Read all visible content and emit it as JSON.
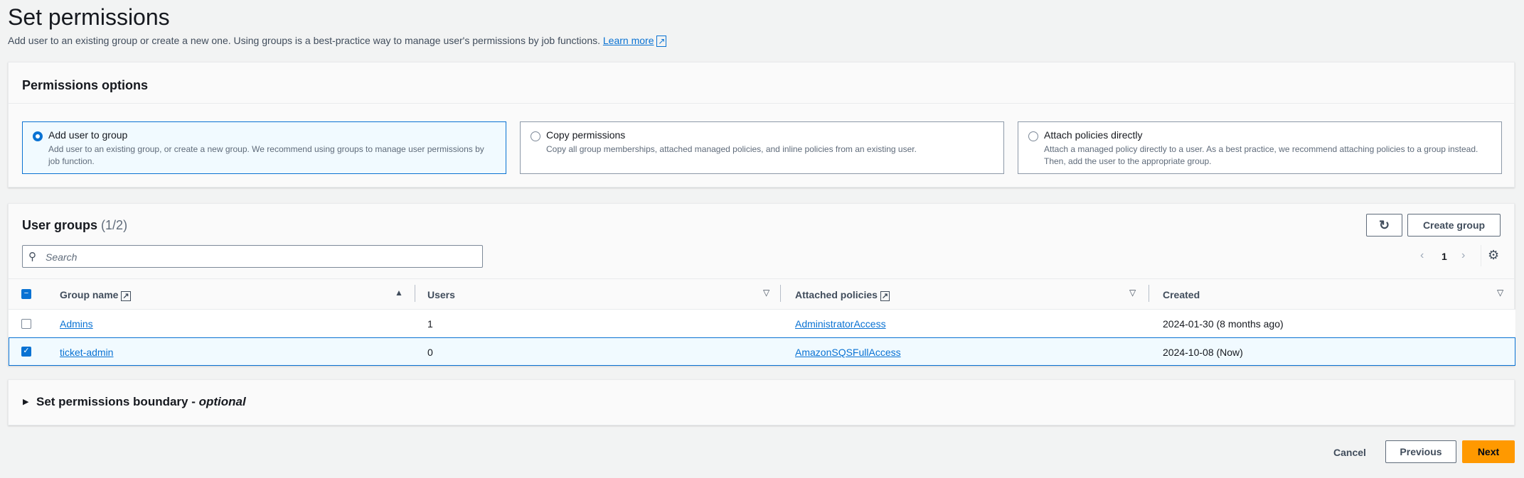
{
  "page": {
    "title": "Set permissions",
    "subtitle": "Add user to an existing group or create a new one. Using groups is a best-practice way to manage user's permissions by job functions.",
    "learn_more": "Learn more"
  },
  "options": {
    "title": "Permissions options",
    "selected": "Add user to group",
    "items": [
      {
        "label": "Add user to group",
        "desc": "Add user to an existing group, or create a new group. We recommend using groups to manage user permissions by job function."
      },
      {
        "label": "Copy permissions",
        "desc": "Copy all group memberships, attached managed policies, and inline policies from an existing user."
      },
      {
        "label": "Attach policies directly",
        "desc": "Attach a managed policy directly to a user. As a best practice, we recommend attaching policies to a group instead. Then, add the user to the appropriate group."
      }
    ]
  },
  "groups": {
    "title": "User groups",
    "count": "(1/2)",
    "create": "Create group",
    "search_placeholder": "Search",
    "page": "1",
    "columns": [
      "Group name",
      "Users",
      "Attached policies",
      "Created"
    ],
    "rows": [
      {
        "name": "Admins",
        "users": "1",
        "policies": "AdministratorAccess",
        "created": "2024-01-30 (8 months ago)",
        "selected": false
      },
      {
        "name": "ticket-admin",
        "users": "0",
        "policies": "AmazonSQSFullAccess",
        "created": "2024-10-08 (Now)",
        "selected": true
      }
    ]
  },
  "boundary": {
    "title": "Set permissions boundary",
    "optional": "optional"
  },
  "footer": {
    "cancel": "Cancel",
    "previous": "Previous",
    "next": "Next"
  },
  "colors": {
    "primary": "#ff9900",
    "link": "#0972d3"
  }
}
